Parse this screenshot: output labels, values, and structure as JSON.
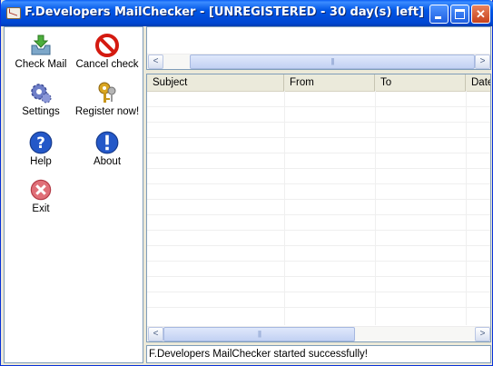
{
  "window": {
    "title": "F.Developers MailChecker - [UNREGISTERED - 30 day(s) left]",
    "minimize_glyph": "_",
    "close_glyph": "✕"
  },
  "sidebar": {
    "tools": [
      {
        "label": "Check Mail",
        "icon": "check-mail-icon"
      },
      {
        "label": "Cancel check",
        "icon": "cancel-icon"
      },
      {
        "label": "Settings",
        "icon": "gears-icon"
      },
      {
        "label": "Register now!",
        "icon": "keys-icon"
      },
      {
        "label": "Help",
        "icon": "help-icon"
      },
      {
        "label": "About",
        "icon": "about-icon"
      },
      {
        "label": "Exit",
        "icon": "exit-icon"
      }
    ]
  },
  "messages_table": {
    "columns": [
      "Subject",
      "From",
      "To",
      "Date"
    ]
  },
  "scrollbar": {
    "left_arrow": "<",
    "right_arrow": ">",
    "grip": "|||"
  },
  "status_bar": {
    "text": "F.Developers MailChecker started successfully!"
  },
  "colors": {
    "titlebar": "#0055e5",
    "panel_border": "#7f9db9",
    "window_bg": "#ece9d8"
  }
}
